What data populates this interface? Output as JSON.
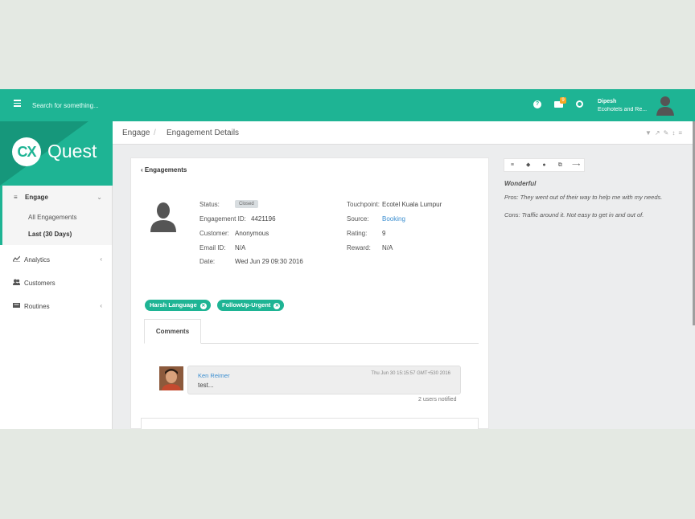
{
  "topbar": {
    "search_placeholder": "Search for something...",
    "mail_badge": "9",
    "help_glyph": "?",
    "user_name": "Dipesh",
    "user_org": "Ecohotels and Re..."
  },
  "sidebar": {
    "logo_cx": "CX",
    "logo_quest": "Quest",
    "engage": {
      "label": "Engage",
      "icon": "list-icon",
      "children": [
        "All Engagements",
        "Last (30 Days)"
      ]
    },
    "items": [
      {
        "label": "Analytics",
        "icon": "line-chart-icon"
      },
      {
        "label": "Customers",
        "icon": "users-icon"
      },
      {
        "label": "Routines",
        "icon": "routine-icon"
      }
    ]
  },
  "breadcrumb": {
    "root": "Engage",
    "separator": "/",
    "current": "Engagement Details"
  },
  "card": {
    "back_label": "Engagements",
    "left_fields": [
      {
        "label": "Status:",
        "value": "Closed"
      },
      {
        "label": "Engagement ID:",
        "value": "4421196"
      },
      {
        "label": "Customer:",
        "value": "Anonymous"
      },
      {
        "label": "Email ID:",
        "value": "N/A"
      },
      {
        "label": "Date:",
        "value": "Wed Jun 29 09:30 2016"
      }
    ],
    "right_fields": [
      {
        "label": "Touchpoint:",
        "value": "Ecotel Kuala Lumpur"
      },
      {
        "label": "Source:",
        "value": "Booking"
      },
      {
        "label": "Rating:",
        "value": "9"
      },
      {
        "label": "Reward:",
        "value": "N/A"
      }
    ],
    "tags": [
      "Harsh Language",
      "FollowUp-Urgent"
    ],
    "tab_label": "Comments",
    "comment": {
      "author": "Ken Reimer",
      "time": "Thu Jun 30 15:15:57 GMT+530 2016",
      "text": "test...",
      "notified": "2 users notified"
    }
  },
  "review": {
    "title": "Wonderful",
    "pros": "Pros: They went out of their way to help me with my needs.",
    "cons": "Cons: Traffic around it. Not easy to get in and out of."
  },
  "colors": {
    "accent": "#1eb494",
    "link": "#3b8ed0",
    "badge": "#f5a623"
  }
}
